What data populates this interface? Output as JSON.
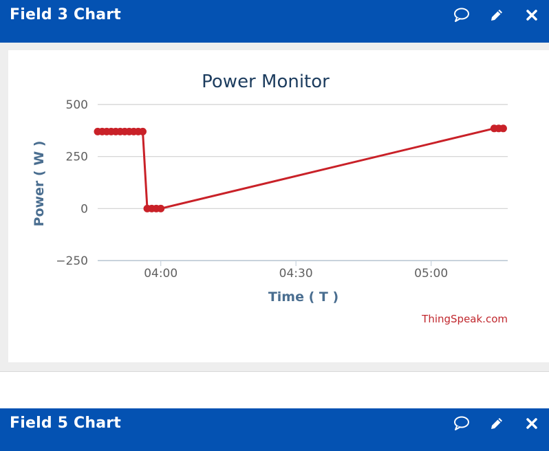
{
  "panels": [
    {
      "title": "Field 3 Chart",
      "icons": [
        "comment-icon",
        "pencil-icon",
        "close-icon"
      ]
    },
    {
      "title": "Field 5 Chart",
      "icons": [
        "comment-icon",
        "pencil-icon",
        "close-icon"
      ]
    }
  ],
  "colors": {
    "header": "#0452b2",
    "line": "#c92128",
    "title": "#1c3c5e",
    "axis_label": "#4a6e90"
  },
  "chart_data": {
    "type": "line",
    "title": "Power Monitor",
    "xlabel": "Time ( T )",
    "ylabel": "Power ( W )",
    "credit": "ThingSpeak.com",
    "ylim": [
      -250,
      500
    ],
    "yticks": [
      500,
      250,
      0,
      -250
    ],
    "yticklabels": [
      "500",
      "250",
      "0",
      "−250"
    ],
    "xlim": [
      "03:46",
      "05:17"
    ],
    "xticks": [
      "04:00",
      "04:30",
      "05:00"
    ],
    "grid": true,
    "series": [
      {
        "x": [
          "03:46",
          "03:47",
          "03:48",
          "03:49",
          "03:50",
          "03:51",
          "03:52",
          "03:53",
          "03:54",
          "03:55",
          "03:56",
          "03:57",
          "03:58",
          "03:59",
          "04:00",
          "05:14",
          "05:15",
          "05:16"
        ],
        "y": [
          370,
          370,
          370,
          370,
          370,
          370,
          370,
          370,
          370,
          370,
          370,
          0,
          0,
          0,
          0,
          385,
          385,
          385
        ]
      }
    ]
  }
}
